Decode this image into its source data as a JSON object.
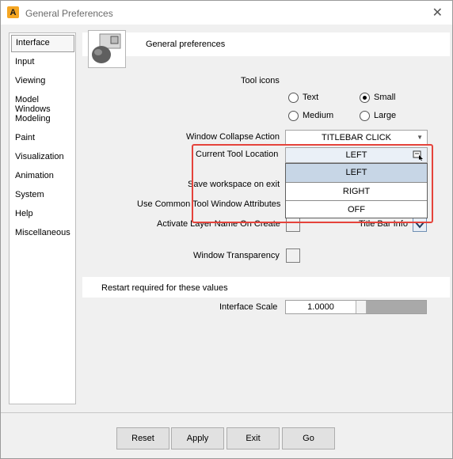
{
  "window": {
    "title": "General Preferences",
    "app_icon_glyph": "A",
    "close_glyph": "✕"
  },
  "sidebar": {
    "items": [
      {
        "label": "Interface"
      },
      {
        "label": "Input"
      },
      {
        "label": "Viewing"
      },
      {
        "label": "Model Windows"
      },
      {
        "label": "Modeling"
      },
      {
        "label": "Paint"
      },
      {
        "label": "Visualization"
      },
      {
        "label": "Animation"
      },
      {
        "label": "System"
      },
      {
        "label": "Help"
      },
      {
        "label": "Miscellaneous"
      }
    ],
    "selected": "Interface"
  },
  "header": {
    "title": "General preferences",
    "icon": "preferences-icon"
  },
  "tool_icons": {
    "label": "Tool icons",
    "options": [
      {
        "label": "Text",
        "checked": false
      },
      {
        "label": "Small",
        "checked": true
      },
      {
        "label": "Medium",
        "checked": false
      },
      {
        "label": "Large",
        "checked": false
      }
    ]
  },
  "window_collapse": {
    "label": "Window Collapse Action",
    "value": "TITLEBAR CLICK"
  },
  "tool_location": {
    "label": "Current Tool Location",
    "value": "LEFT",
    "options": [
      "LEFT",
      "RIGHT",
      "OFF"
    ]
  },
  "save_workspace": {
    "label": "Save workspace on exit"
  },
  "common_tool_window": {
    "label": "Use Common Tool Window Attributes"
  },
  "activate_layer": {
    "label": "Activate Layer Name On Create"
  },
  "title_bar_info": {
    "label": "Title Bar Info",
    "checked": true
  },
  "window_transparency": {
    "label": "Window Transparency",
    "checked": false
  },
  "restart": {
    "label": "Restart required for these values"
  },
  "interface_scale": {
    "label": "Interface Scale",
    "value": "1.0000"
  },
  "buttons": {
    "reset": "Reset",
    "apply": "Apply",
    "exit": "Exit",
    "go": "Go"
  },
  "colors": {
    "highlight": "#e5433b",
    "selected_option": "#c7d6e6",
    "app_icon": "#f5a623"
  }
}
